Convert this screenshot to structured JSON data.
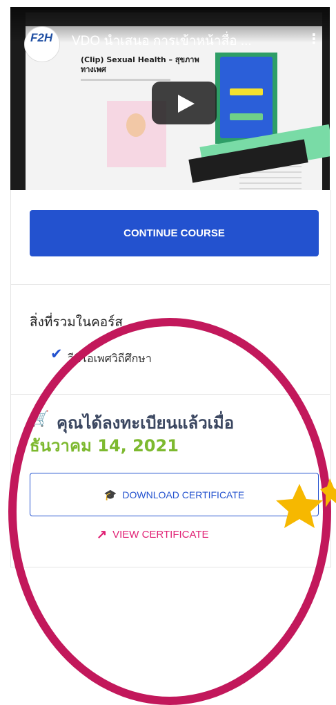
{
  "video": {
    "title": "VDO นำเสนอ การเข้าหน้าสื่อ ...",
    "channel_logo": "F2H",
    "screen_heading": "(Clip) Sexual Health – สุขภาพทางเพศ",
    "menu_icon": "more-vert-icon",
    "play_icon": "play-icon"
  },
  "course": {
    "continue_label": "CONTINUE COURSE",
    "includes_title": "สิ่งที่รวมในคอร์ส",
    "include_items": [
      "วีดีโอเพศวิถีศึกษา"
    ],
    "enrolled_label": "คุณได้ลงทะเบียนแล้วเมื่อ",
    "enrolled_date": "ธันวาคม 14, 2021",
    "download_label": "DOWNLOAD CERTIFICATE",
    "view_label": "VIEW CERTIFICATE"
  },
  "colors": {
    "accent_blue": "#2352cf",
    "date_green": "#7db92f",
    "view_pink": "#e01f73",
    "circle_magenta": "#c2185b",
    "star_yellow": "#f6b800"
  }
}
